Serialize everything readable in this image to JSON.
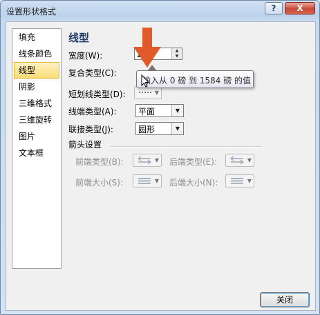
{
  "window": {
    "title": "设置形状格式",
    "help_label": "?",
    "close_label": "X"
  },
  "nav": {
    "items": [
      {
        "label": "填充"
      },
      {
        "label": "线条颜色"
      },
      {
        "label": "线型",
        "active": true
      },
      {
        "label": "阴影"
      },
      {
        "label": "三维格式"
      },
      {
        "label": "三维旋转"
      },
      {
        "label": "图片"
      },
      {
        "label": "文本框"
      }
    ]
  },
  "panel": {
    "title": "线型",
    "width": {
      "label": "宽度(W):",
      "value": "1 磅"
    },
    "compound": {
      "label": "复合类型(C):"
    },
    "dash": {
      "label": "短划线类型(D):"
    },
    "cap": {
      "label": "线端类型(A):",
      "value": "平面"
    },
    "join": {
      "label": "联接类型(J):",
      "value": "圆形"
    },
    "arrow_settings": {
      "heading": "箭头设置",
      "begin_type": "前端类型(B):",
      "end_type": "后端类型(E):",
      "begin_size": "前端大小(S):",
      "end_size": "后端大小(N):"
    }
  },
  "tooltip": {
    "text": "输入从 0 磅 到 1584 磅 的值"
  },
  "footer": {
    "close_button": "关闭"
  },
  "colors": {
    "accent_arrow": "#e05a2b",
    "active_nav": "#f9dc77"
  }
}
